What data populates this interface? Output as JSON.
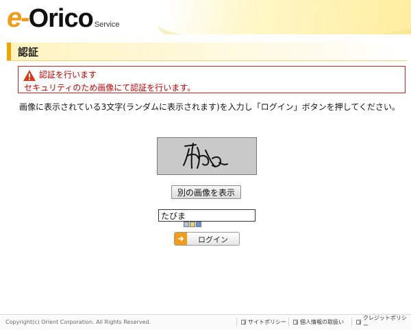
{
  "header": {
    "logo_e": "e-",
    "logo_orico": "Orico",
    "logo_service": "Service"
  },
  "page": {
    "title": "認証"
  },
  "alert": {
    "icon": "warning-triangle-icon",
    "heading": "認証を行います",
    "message": "セキュリティのため画像にて認証を行います。",
    "color": "#cc0000"
  },
  "instruction": "画像に表示されている3文字(ランダムに表示されます)を入力し「ログイン」ボタンを押してください。",
  "captcha": {
    "other_image_label": "別の画像を表示"
  },
  "form": {
    "answer_value": "たびま",
    "login_label": "ログイン"
  },
  "footer": {
    "copyright": "Copyright(c) Orient Corporation. All Rights Reserved.",
    "links": [
      "サイトポリシー",
      "個人情報の取扱い",
      "クレジットポリシー"
    ]
  },
  "colors": {
    "brand_orange": "#f29b18",
    "title_accent": "#f0a400"
  }
}
